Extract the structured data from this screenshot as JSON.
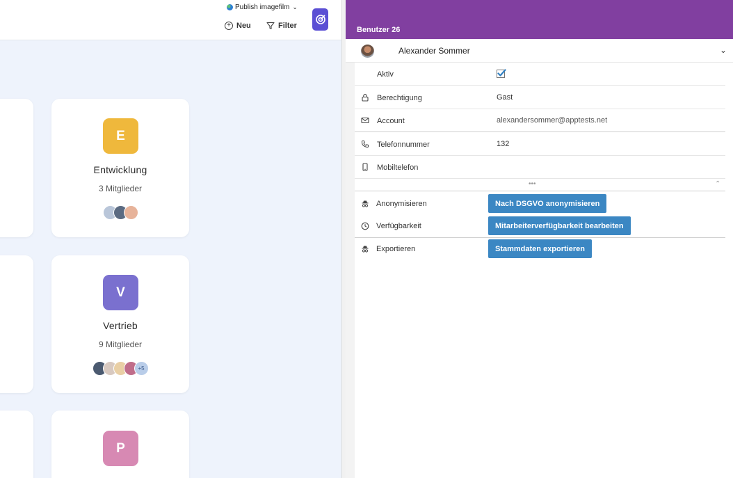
{
  "toolbar": {
    "publish_label": "Publish imagefilm",
    "new_label": "Neu",
    "filter_label": "Filter"
  },
  "groups": [
    {
      "letter": "E",
      "name": "Entwicklung",
      "members": "3 Mitglieder",
      "color": "#efb83c",
      "avatars": [
        "#b9c6d9",
        "#5b6b82",
        "#e7b39a"
      ],
      "extra": ""
    },
    {
      "letter": "V",
      "name": "Vertrieb",
      "members": "9 Mitglieder",
      "color": "#7a70cf",
      "avatars": [
        "#4b5a70",
        "#d8c9c0",
        "#e9cfa5",
        "#c06d8a"
      ],
      "extra": "+5"
    },
    {
      "letter": "P",
      "name": "",
      "members": "",
      "color": "#d789b3",
      "avatars": [],
      "extra": ""
    }
  ],
  "panel": {
    "title": "Benutzer 26",
    "user_name": "Alexander Sommer",
    "header_color": "#813fa0",
    "fields": [
      {
        "icon": "none",
        "label": "Aktiv",
        "value": "",
        "checked": true
      },
      {
        "icon": "lock-icon",
        "label": "Berechtigung",
        "value": "Gast"
      },
      {
        "icon": "mail-icon",
        "label": "Account",
        "value": "alexandersommer@apptests.net"
      },
      {
        "icon": "phone-icon",
        "label": "Telefonnummer",
        "value": "132"
      },
      {
        "icon": "mobile-icon",
        "label": "Mobiltelefon",
        "value": ""
      }
    ],
    "actions": [
      {
        "icon": "spy-icon",
        "label": "Anonymisieren",
        "button": "Nach DSGVO anonymisieren"
      },
      {
        "icon": "clock-icon",
        "label": "Verfügbarkeit",
        "button": "Mitarbeiterverfügbarkeit bearbeiten"
      },
      {
        "icon": "spy-icon",
        "label": "Exportieren",
        "button": "Stammdaten exportieren"
      }
    ],
    "button_color": "#3b87c3"
  }
}
